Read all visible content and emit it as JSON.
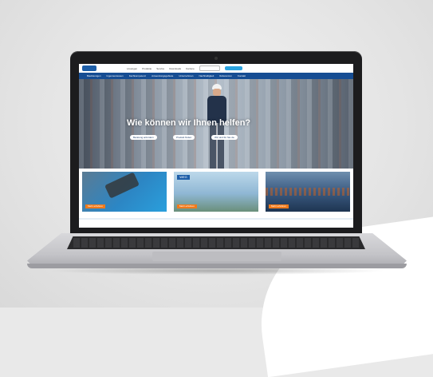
{
  "site": {
    "top_nav": [
      "Lösungen",
      "Produkte",
      "Service",
      "Downloads",
      "Karriere"
    ],
    "nav_items": [
      "Baulösungen",
      "Ingenieurwesen",
      "Fachkompetenz",
      "Anwendungsgebiete",
      "Unternehmen",
      "Nachhaltigkeit",
      "Referenzen",
      "Kontakt"
    ],
    "hero_title": "Wie können wir Ihnen helfen?",
    "hero_buttons": [
      "Beratung anfordern",
      "Produkt finden",
      "Wir sind für Sie da"
    ],
    "tiles": [
      {
        "button": "Mehr erfahren"
      },
      {
        "sign": "WEG",
        "button": "Mehr erfahren"
      },
      {
        "button": "Mehr erfahren"
      }
    ]
  },
  "colors": {
    "nav_blue": "#164d93",
    "accent_orange": "#f07a1b",
    "cta_blue": "#2aa3e0"
  }
}
